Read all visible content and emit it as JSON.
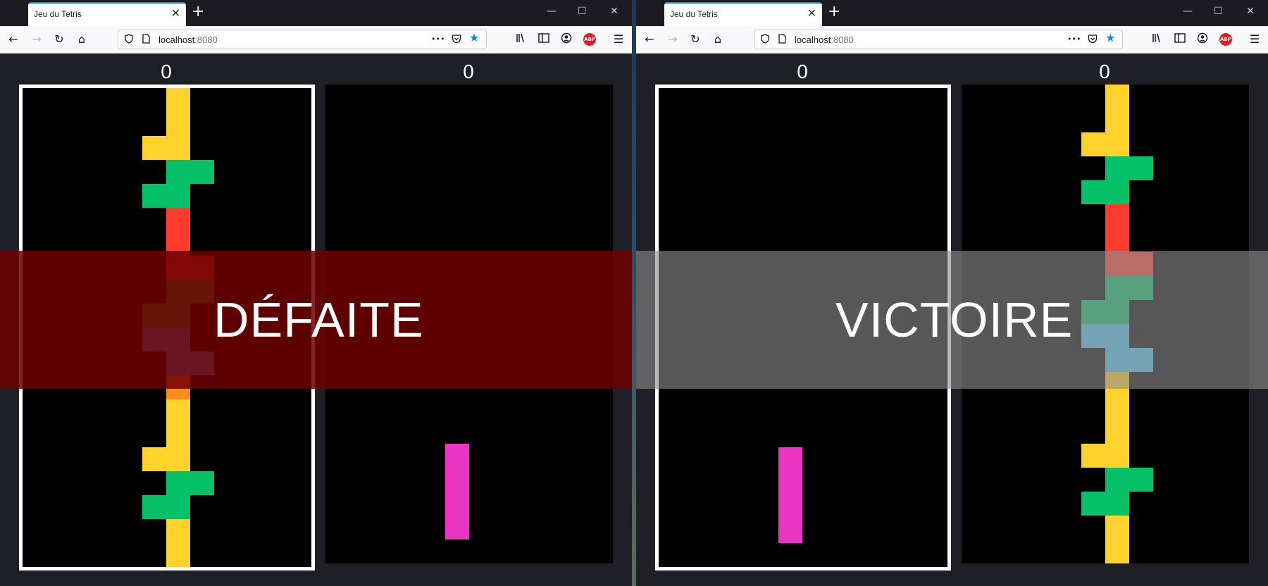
{
  "windows": [
    {
      "id": "left",
      "tab": {
        "title": "Jeu du Tetris",
        "close": "✕"
      },
      "new_tab": "+",
      "window_controls": {
        "minimize": "—",
        "maximize": "☐",
        "close": "✕"
      },
      "nav": {
        "back": "←",
        "forward": "→",
        "reload": "↻",
        "home": "⌂"
      },
      "url": {
        "host": "localhost",
        "port": ":8080"
      },
      "url_icons": {
        "shield": "shield-icon",
        "page": "page-icon",
        "more": "•••",
        "pocket": "pocket-icon",
        "star": "★"
      },
      "toolbar_icons": {
        "library": "library-icon",
        "sidebar": "sidebar-icon",
        "account": "account-icon",
        "abp": "ABP",
        "menu": "☰"
      },
      "scores": [
        "0",
        "0"
      ],
      "overlay": {
        "text": "DÉFAITE",
        "color": "#6e0000"
      },
      "active_board": 0,
      "boards": [
        {
          "cells": [
            [
              6,
              0,
              "#ffd22c"
            ],
            [
              6,
              1,
              "#ffd22c"
            ],
            [
              6,
              2,
              "#ffd22c"
            ],
            [
              5,
              2,
              "#ffd22c"
            ],
            [
              6,
              3,
              "#06c167"
            ],
            [
              7,
              3,
              "#06c167"
            ],
            [
              5,
              4,
              "#06c167"
            ],
            [
              6,
              4,
              "#06c167"
            ],
            [
              6,
              5,
              "#ff3b30"
            ],
            [
              6,
              6,
              "#ff3b30"
            ],
            [
              6,
              7,
              "#ff3b30"
            ],
            [
              7,
              7,
              "#ff3b30"
            ],
            [
              6,
              8,
              "#3a8a3a"
            ],
            [
              7,
              8,
              "#3a8a3a"
            ],
            [
              5,
              9,
              "#3a8a3a"
            ],
            [
              6,
              9,
              "#3a8a3a"
            ],
            [
              5,
              10,
              "#4a90e2"
            ],
            [
              6,
              10,
              "#4a90e2"
            ],
            [
              6,
              11,
              "#4a90e2"
            ],
            [
              7,
              11,
              "#4a90e2"
            ],
            [
              6,
              12,
              "#ff8c1a"
            ],
            [
              6,
              13,
              "#ffd22c"
            ],
            [
              6,
              14,
              "#ffd22c"
            ],
            [
              5,
              15,
              "#ffd22c"
            ],
            [
              6,
              15,
              "#ffd22c"
            ],
            [
              6,
              16,
              "#06c167"
            ],
            [
              7,
              16,
              "#06c167"
            ],
            [
              5,
              17,
              "#06c167"
            ],
            [
              6,
              17,
              "#06c167"
            ],
            [
              6,
              18,
              "#ffd22c"
            ],
            [
              6,
              19,
              "#ffd22c"
            ],
            [
              5,
              20,
              "#ffd22c"
            ],
            [
              6,
              20,
              "#ffd22c"
            ]
          ]
        },
        {
          "cells": [
            [
              5,
              15,
              "#ea35c4"
            ],
            [
              5,
              16,
              "#ea35c4"
            ],
            [
              5,
              17,
              "#ea35c4"
            ],
            [
              5,
              18,
              "#ea35c4"
            ]
          ]
        }
      ]
    },
    {
      "id": "right",
      "tab": {
        "title": "Jeu du Tetris",
        "close": "✕"
      },
      "new_tab": "+",
      "window_controls": {
        "minimize": "—",
        "maximize": "☐",
        "close": "✕"
      },
      "nav": {
        "back": "←",
        "forward": "→",
        "reload": "↻",
        "home": "⌂"
      },
      "url": {
        "host": "localhost",
        "port": ":8080"
      },
      "url_icons": {
        "shield": "shield-icon",
        "page": "page-icon",
        "more": "•••",
        "pocket": "pocket-icon",
        "star": "★"
      },
      "toolbar_icons": {
        "library": "library-icon",
        "sidebar": "sidebar-icon",
        "account": "account-icon",
        "abp": "ABP",
        "menu": "☰"
      },
      "scores": [
        "0",
        "0"
      ],
      "overlay": {
        "text": "VICTOIRE",
        "color": "#8c8c8c"
      },
      "active_board": 0,
      "boards": [
        {
          "cells": [
            [
              5,
              15,
              "#ea35c4"
            ],
            [
              5,
              16,
              "#ea35c4"
            ],
            [
              5,
              17,
              "#ea35c4"
            ],
            [
              5,
              18,
              "#ea35c4"
            ]
          ]
        },
        {
          "cells": [
            [
              6,
              0,
              "#ffd22c"
            ],
            [
              6,
              1,
              "#ffd22c"
            ],
            [
              6,
              2,
              "#ffd22c"
            ],
            [
              5,
              2,
              "#ffd22c"
            ],
            [
              6,
              3,
              "#06c167"
            ],
            [
              7,
              3,
              "#06c167"
            ],
            [
              5,
              4,
              "#06c167"
            ],
            [
              6,
              4,
              "#06c167"
            ],
            [
              6,
              5,
              "#ff3b30"
            ],
            [
              6,
              6,
              "#ff3b30"
            ],
            [
              6,
              7,
              "#ff3b30"
            ],
            [
              7,
              7,
              "#ff3b30"
            ],
            [
              6,
              8,
              "#06c167"
            ],
            [
              7,
              8,
              "#06c167"
            ],
            [
              5,
              9,
              "#06c167"
            ],
            [
              6,
              9,
              "#06c167"
            ],
            [
              5,
              10,
              "#4ac8f5"
            ],
            [
              6,
              10,
              "#4ac8f5"
            ],
            [
              6,
              11,
              "#4ac8f5"
            ],
            [
              7,
              11,
              "#4ac8f5"
            ],
            [
              6,
              12,
              "#ffd22c"
            ],
            [
              6,
              13,
              "#ffd22c"
            ],
            [
              6,
              14,
              "#ffd22c"
            ],
            [
              5,
              15,
              "#ffd22c"
            ],
            [
              6,
              15,
              "#ffd22c"
            ],
            [
              6,
              16,
              "#06c167"
            ],
            [
              7,
              16,
              "#06c167"
            ],
            [
              5,
              17,
              "#06c167"
            ],
            [
              6,
              17,
              "#06c167"
            ],
            [
              6,
              18,
              "#ffd22c"
            ],
            [
              6,
              19,
              "#ffd22c"
            ],
            [
              5,
              20,
              "#ffd22c"
            ],
            [
              6,
              20,
              "#ffd22c"
            ]
          ]
        }
      ]
    }
  ]
}
